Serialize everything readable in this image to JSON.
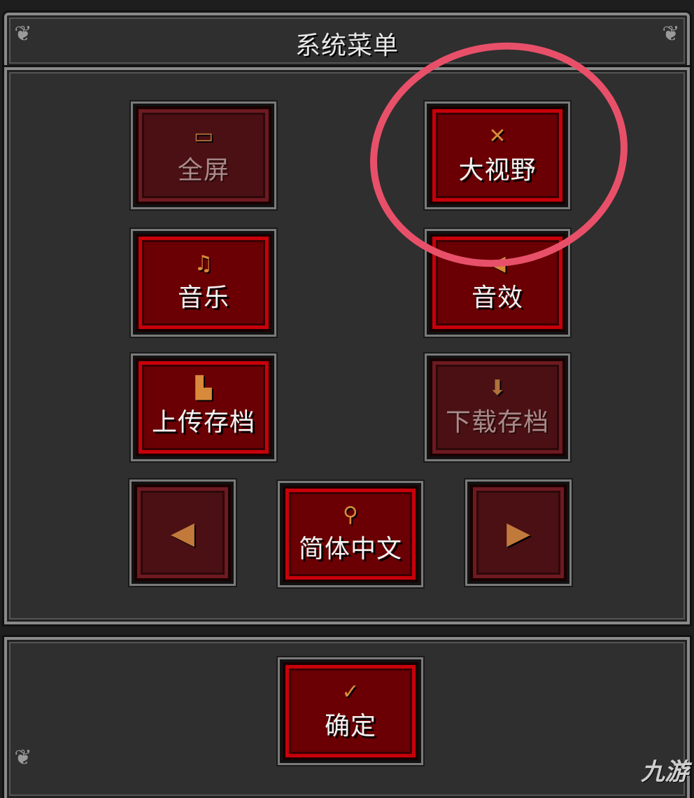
{
  "menu": {
    "title": "系统菜单"
  },
  "buttons": {
    "fullscreen": {
      "label": "全屏",
      "icon": "window-icon",
      "glyph": "▭"
    },
    "wide_view": {
      "label": "大视野",
      "icon": "x-cross-icon",
      "glyph": "✕"
    },
    "music": {
      "label": "音乐",
      "icon": "music-note-icon",
      "glyph": "♫"
    },
    "sound_effects": {
      "label": "音效",
      "icon": "speaker-icon",
      "glyph": "◀"
    },
    "upload_save": {
      "label": "上传存档",
      "icon": "document-icon",
      "glyph": "▙"
    },
    "download_save": {
      "label": "下载存档",
      "icon": "down-arrow-icon",
      "glyph": "⬇"
    },
    "prev_language": {
      "icon": "left-arrow-icon",
      "glyph": "◀"
    },
    "language": {
      "label": "简体中文",
      "icon": "globe-icon",
      "glyph": "⚲"
    },
    "next_language": {
      "icon": "right-arrow-icon",
      "glyph": "▶"
    },
    "confirm": {
      "label": "确定",
      "icon": "checkmark-icon",
      "glyph": "✓"
    }
  },
  "watermark": {
    "text": "九游"
  },
  "colors": {
    "button_red": "#c8000a",
    "button_fill": "#6a0004",
    "panel": "#2f2f2f",
    "icon_orange": "#d88a3a",
    "annotation": "#e8506a"
  }
}
